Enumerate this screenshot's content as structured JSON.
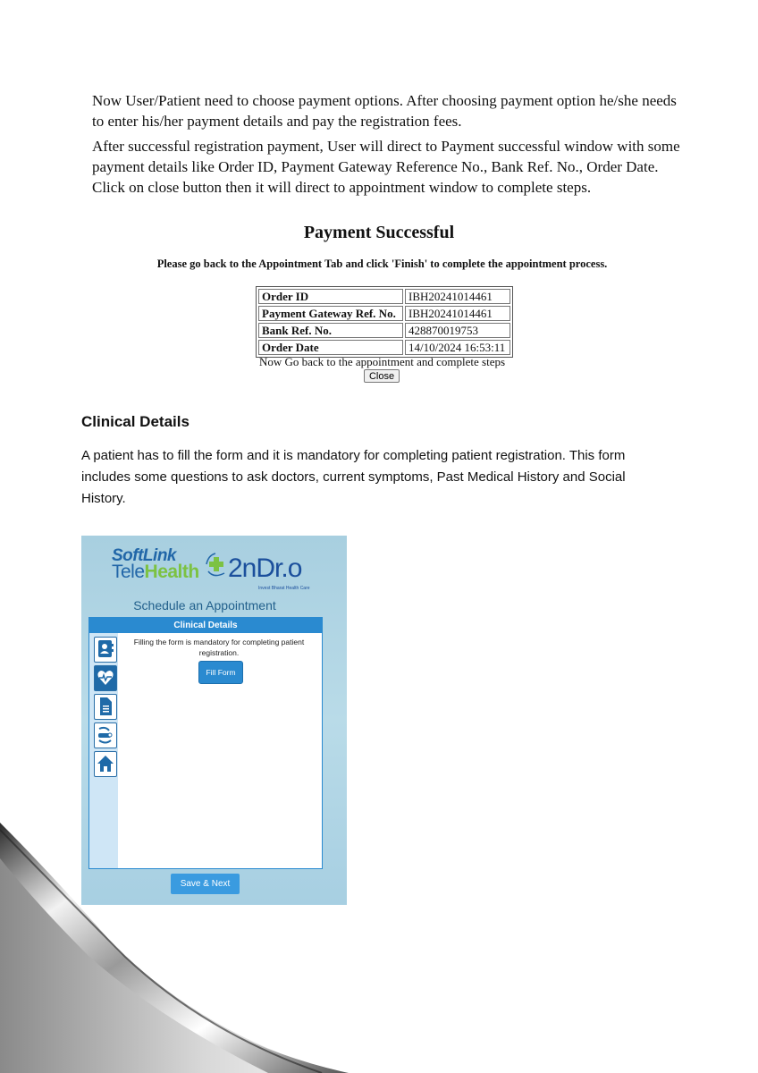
{
  "intro": {
    "paragraph1": "Now User/Patient need to choose payment options. After choosing payment option he/she needs to enter his/her payment details and pay the registration fees.",
    "paragraph2": "After successful registration payment, User will direct to Payment successful window with some payment details like Order ID, Payment Gateway Reference No., Bank Ref. No., Order Date. Click on close button then it will direct to appointment window to complete steps."
  },
  "payment": {
    "title": "Payment Successful",
    "note": "Please go back to the Appointment Tab and click 'Finish' to complete the appointment process.",
    "rows": [
      {
        "label": "Order ID",
        "value": "IBH20241014461"
      },
      {
        "label": "Payment Gateway Ref. No.",
        "value": "IBH20241014461"
      },
      {
        "label": "Bank Ref. No.",
        "value": "428870019753"
      },
      {
        "label": "Order Date",
        "value": "14/10/2024 16:53:11"
      }
    ],
    "footer": "Now Go back to the appointment and complete steps",
    "close_label": "Close"
  },
  "clinical": {
    "heading": "Clinical Details",
    "paragraph": "A patient has to fill the form and it is mandatory for completing patient registration. This form includes some questions to ask doctors, current symptoms, Past Medical History and Social History."
  },
  "app": {
    "logo": {
      "softlink": "SoftLink",
      "tele": "Tele",
      "health": "Health",
      "brand": "2nDr.o",
      "tagline": "Invest Bharat Health Care"
    },
    "heading": "Schedule an Appointment",
    "panel_title": "Clinical Details",
    "panel_text": "Filling the form is mandatory for completing patient registration.",
    "fill_form_label": "Fill Form",
    "save_next_label": "Save & Next",
    "side_icons": [
      "contact-card-icon",
      "heart-pulse-icon",
      "document-icon",
      "doctor-icon",
      "home-icon"
    ],
    "colors": {
      "primary": "#2a8ad0",
      "brand_blue": "#2166a8",
      "brand_green": "#7cc242"
    }
  }
}
